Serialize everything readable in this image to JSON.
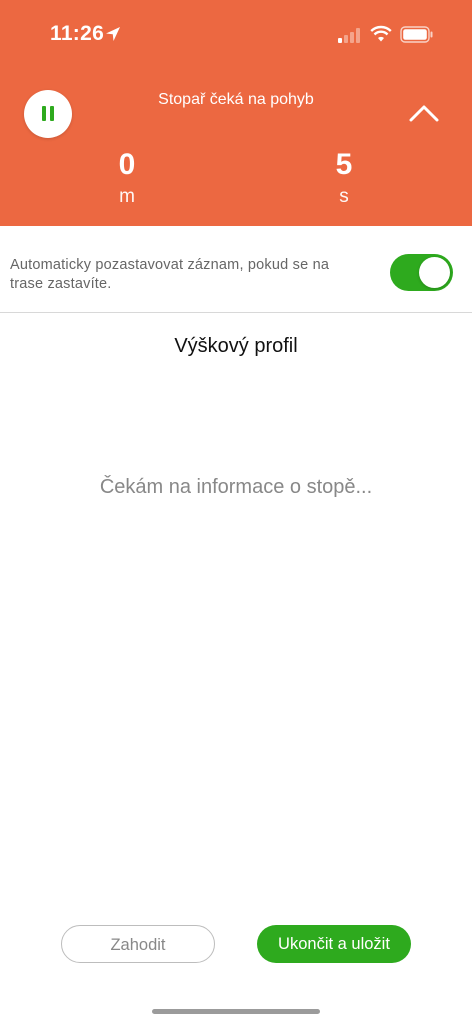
{
  "status_bar": {
    "time": "11:26",
    "icons": [
      "location-arrow-icon",
      "cellular-signal-icon",
      "wifi-icon",
      "battery-icon"
    ]
  },
  "header": {
    "title": "Stopař čeká na pohyb",
    "distance_value": "0",
    "distance_unit": "m",
    "time_value": "5",
    "time_unit": "s",
    "pause_icon": "pause-icon",
    "collapse_icon": "chevron-up-icon",
    "background_color": "#ec6841"
  },
  "auto_pause": {
    "label": "Automaticky pozastavovat záznam, pokud se na trase zastavíte.",
    "enabled": true,
    "toggle_color": "#2eaa1e"
  },
  "elevation_profile": {
    "title": "Výškový profil",
    "waiting_message": "Čekám na informace o stopě..."
  },
  "actions": {
    "discard_label": "Zahodit",
    "save_label": "Ukončit a uložit",
    "save_color": "#2eaa1e"
  }
}
